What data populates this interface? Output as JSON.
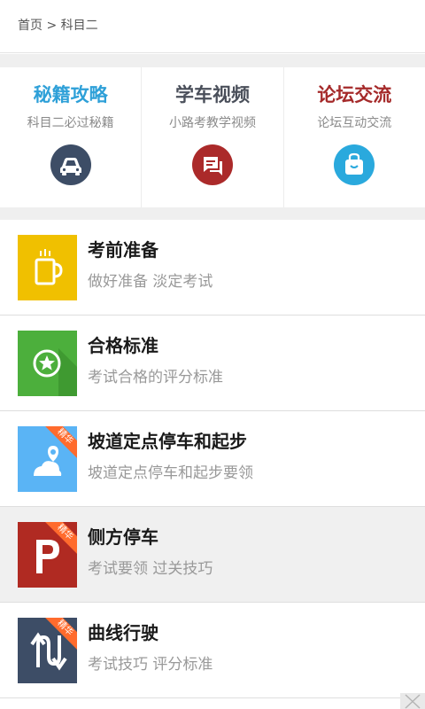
{
  "breadcrumb": {
    "text": "首页 > 科目二"
  },
  "features": [
    {
      "title": "秘籍攻略",
      "subtitle": "科目二必过秘籍",
      "title_color": "#2ea0d8",
      "icon": "car-icon",
      "icon_color": "#3d4d66"
    },
    {
      "title": "学车视频",
      "subtitle": "小路考教学视频",
      "title_color": "#4a4f5a",
      "icon": "chat-icon",
      "icon_color": "#ab2a2a"
    },
    {
      "title": "论坛交流",
      "subtitle": "论坛互动交流",
      "title_color": "#a52a2a",
      "icon": "bag-icon",
      "icon_color": "#2aa9dd"
    }
  ],
  "items": [
    {
      "title": "考前准备",
      "subtitle": "做好准备 淡定考试",
      "icon": "mug-icon",
      "color": "#f0c000",
      "badge": ""
    },
    {
      "title": "合格标准",
      "subtitle": "考试合格的评分标准",
      "icon": "star-badge-icon",
      "color": "#4caf3c",
      "badge": ""
    },
    {
      "title": "坡道定点停车和起步",
      "subtitle": "坡道定点停车和起步要领",
      "icon": "hill-pin-icon",
      "color": "#5ab4f5",
      "badge": "精华"
    },
    {
      "title": "侧方停车",
      "subtitle": "考试要领 过关技巧",
      "icon": "parking-icon",
      "color": "#b02a22",
      "badge": "精华"
    },
    {
      "title": "曲线行驶",
      "subtitle": "考试技巧 评分标准",
      "icon": "curve-arrows-icon",
      "color": "#3d4d66",
      "badge": "精华"
    }
  ]
}
